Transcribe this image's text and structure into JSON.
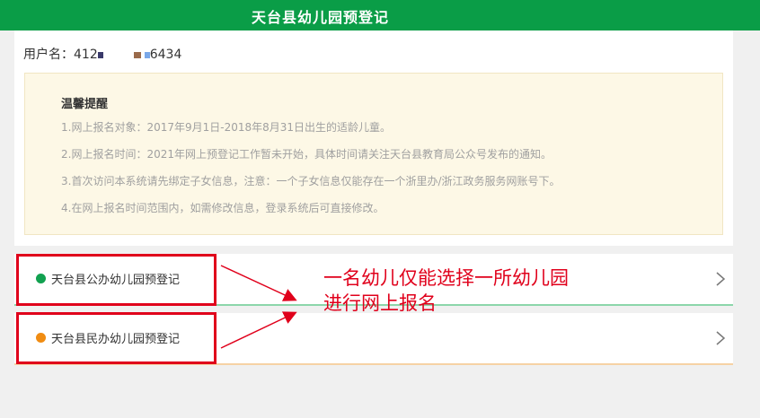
{
  "header": {
    "title": "天台县幼儿园预登记"
  },
  "user": {
    "label": "用户名：",
    "id_prefix": "412",
    "id_suffix": "6434"
  },
  "notice": {
    "title": "温馨提醒",
    "items": [
      "1.网上报名对象：2017年9月1日-2018年8月31日出生的适龄儿童。",
      "2.网上报名时间：2021年网上预登记工作暂未开始，具体时间请关注天台县教育局公众号发布的通知。",
      "3.首次访问本系统请先绑定子女信息，注意：一个子女信息仅能存在一个浙里办/浙江政务服务网账号下。",
      "4.在网上报名时间范围内，如需修改信息，登录系统后可直接修改。"
    ]
  },
  "options": [
    {
      "label": "天台县公办幼儿园预登记",
      "dot_color": "#12a150",
      "icon": "chevron-right-icon"
    },
    {
      "label": "天台县民办幼儿园预登记",
      "dot_color": "#f08c12",
      "icon": "chevron-right-icon"
    }
  ],
  "annotation": {
    "line1": "一名幼儿仅能选择一所幼儿园",
    "line2": "进行网上报名",
    "color": "#e0001b"
  },
  "colors": {
    "brand": "#0a9d47",
    "notice_bg": "#fdf8e6"
  }
}
